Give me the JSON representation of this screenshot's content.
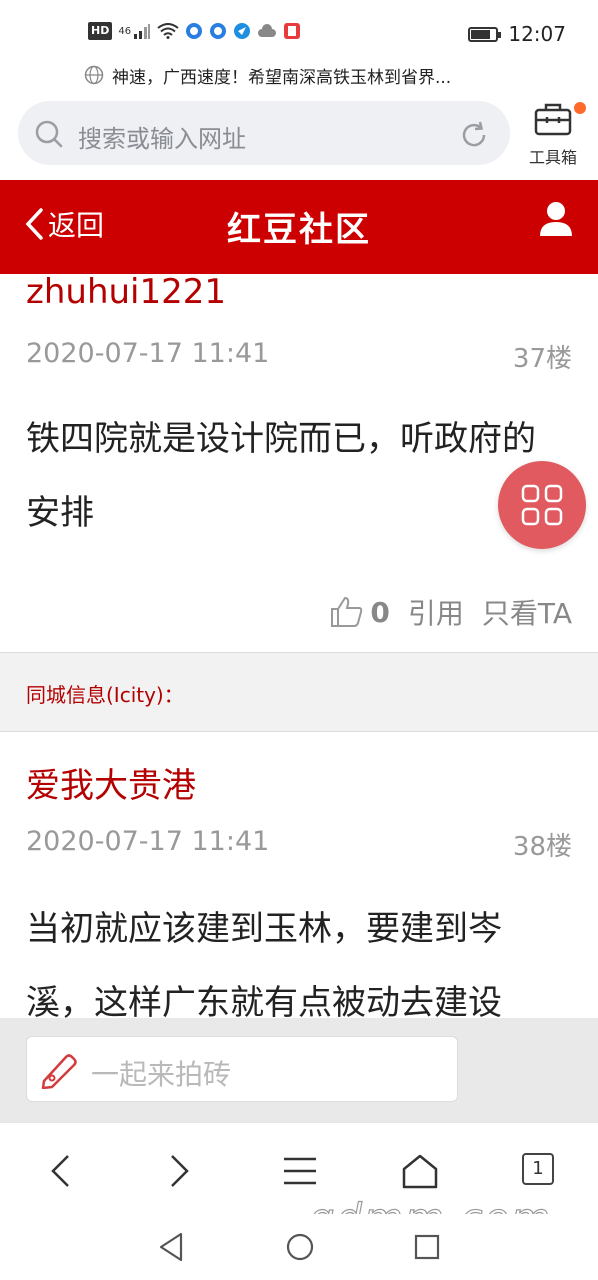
{
  "status_bar": {
    "hd": "HD",
    "network": "46",
    "battery_level": 0.7,
    "time": "12:07"
  },
  "news_ticker": {
    "text": "神速，广西速度！希望南深高铁玉林到省界..."
  },
  "browser": {
    "search_placeholder": "搜索或输入网址",
    "toolbox_label": "工具箱"
  },
  "site_header": {
    "back_label": "返回",
    "title": "红豆社区"
  },
  "posts": [
    {
      "author": "zhuhui1221",
      "time": "2020-07-17 11:41",
      "floor": "37楼",
      "body": "铁四院就是设计院而已，听政府的安排",
      "likes": "0",
      "quote_label": "引用",
      "only_label": "只看TA"
    },
    {
      "author": "爱我大贵港",
      "time": "2020-07-17 11:41",
      "floor": "38楼",
      "body": "当初就应该建到玉林，要建到岑溪，这样广东就有点被动去建设"
    }
  ],
  "icity": {
    "label": "同城信息(Icity)："
  },
  "reply_bar": {
    "placeholder": "一起来拍砖"
  },
  "browser_nav": {
    "tab_count": "1"
  },
  "watermark": "gdmm.com",
  "colors": {
    "brand_red": "#cc0000",
    "author_red": "#b40000",
    "float_button": "#e05a5f"
  }
}
